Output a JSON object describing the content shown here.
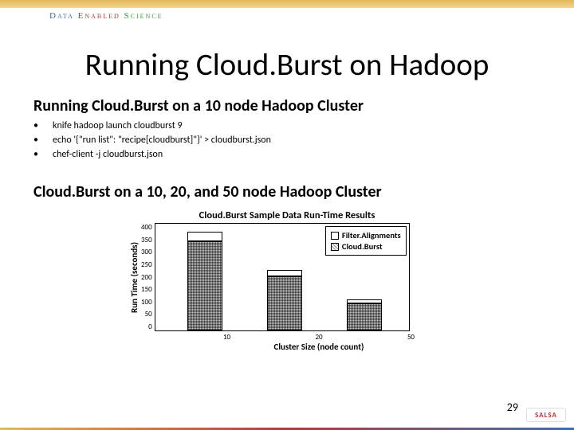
{
  "brand": {
    "d": "Data ",
    "e": "Enabled ",
    "s": "Science"
  },
  "title": "Running Cloud.Burst on Hadoop",
  "subtitle1": "Running Cloud.Burst on a 10 node Hadoop Cluster",
  "bullets": [
    "knife hadoop launch cloudburst 9",
    "echo '{\"run list\": \"recipe[cloudburst]\"}' > cloudburst.json",
    "chef-client -j cloudburst.json"
  ],
  "subtitle2": "Cloud.Burst on a 10, 20, and 50 node Hadoop Cluster",
  "chart_data": {
    "type": "bar",
    "title": "Cloud.Burst Sample Data Run-Time Results",
    "xlabel": "Cluster Size (node count)",
    "ylabel": "Run Time (seconds)",
    "ylim": [
      0,
      400
    ],
    "yticks": [
      400,
      350,
      300,
      250,
      200,
      150,
      100,
      50,
      0
    ],
    "categories": [
      "10",
      "20",
      "50"
    ],
    "series": [
      {
        "name": "Cloud.Burst",
        "values": [
          330,
          200,
          100
        ]
      },
      {
        "name": "Filter.Alignments",
        "values": [
          35,
          25,
          15
        ]
      }
    ],
    "legend_order": [
      "Filter.Alignments",
      "Cloud.Burst"
    ]
  },
  "page_number": "29",
  "footer_logo": "SALSA"
}
